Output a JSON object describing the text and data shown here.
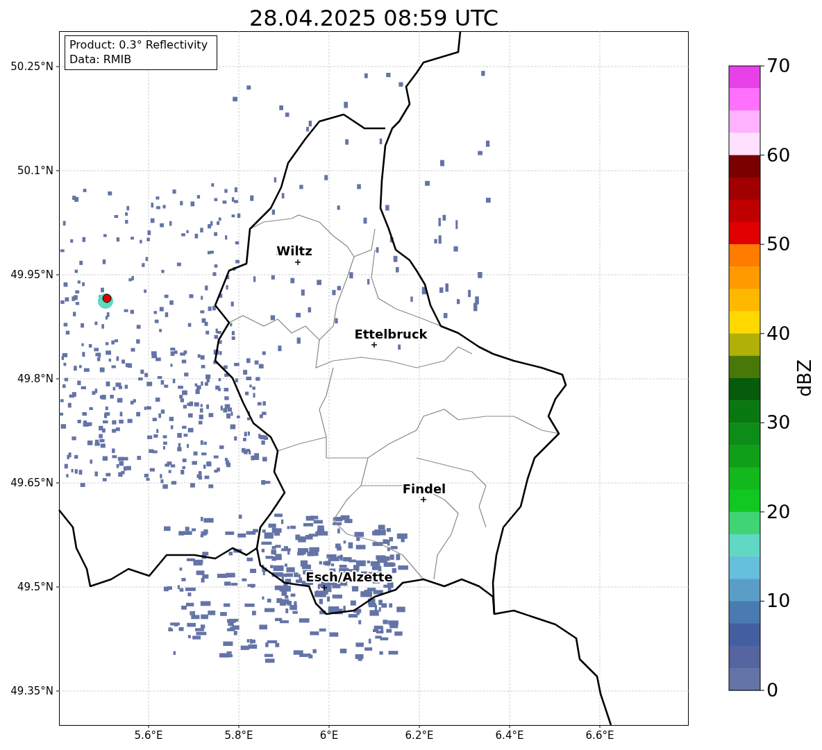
{
  "title": "28.04.2025 08:59 UTC",
  "info_box": {
    "lines": [
      "Product: 0.3° Reflectivity",
      "Data: RMIB"
    ]
  },
  "map": {
    "yticks": [
      "50.25°N",
      "50.1°N",
      "49.95°N",
      "49.8°N",
      "49.65°N",
      "49.5°N",
      "49.35°N"
    ],
    "xticks": [
      "5.6°E",
      "5.8°E",
      "6°E",
      "6.2°E",
      "6.4°E",
      "6.6°E"
    ],
    "cities": [
      {
        "name": "Wiltz"
      },
      {
        "name": "Ettelbruck"
      },
      {
        "name": "Findel"
      },
      {
        "name": "Esch/Alzette"
      }
    ]
  },
  "colorbar": {
    "label": "dBZ",
    "ticks": [
      "70",
      "60",
      "50",
      "40",
      "30",
      "20",
      "10",
      "0"
    ],
    "segments": [
      {
        "color": "#e840e8"
      },
      {
        "color": "#ff70ff"
      },
      {
        "color": "#ffb2ff"
      },
      {
        "color": "#ffe0ff"
      },
      {
        "color": "#7a0000"
      },
      {
        "color": "#a00000"
      },
      {
        "color": "#c00000"
      },
      {
        "color": "#e00000"
      },
      {
        "color": "#ff7c00"
      },
      {
        "color": "#ff9a00"
      },
      {
        "color": "#ffb800"
      },
      {
        "color": "#ffd800"
      },
      {
        "color": "#b0b008"
      },
      {
        "color": "#487808"
      },
      {
        "color": "#065c0a"
      },
      {
        "color": "#0a7810"
      },
      {
        "color": "#0e8c18"
      },
      {
        "color": "#10a018"
      },
      {
        "color": "#12b81c"
      },
      {
        "color": "#10c820"
      },
      {
        "color": "#40d474"
      },
      {
        "color": "#60d8c4"
      },
      {
        "color": "#64c0dc"
      },
      {
        "color": "#5a9ec8"
      },
      {
        "color": "#4a7ab2"
      },
      {
        "color": "#445fa0"
      },
      {
        "color": "#5465a0"
      },
      {
        "color": "#6474a6"
      }
    ]
  }
}
